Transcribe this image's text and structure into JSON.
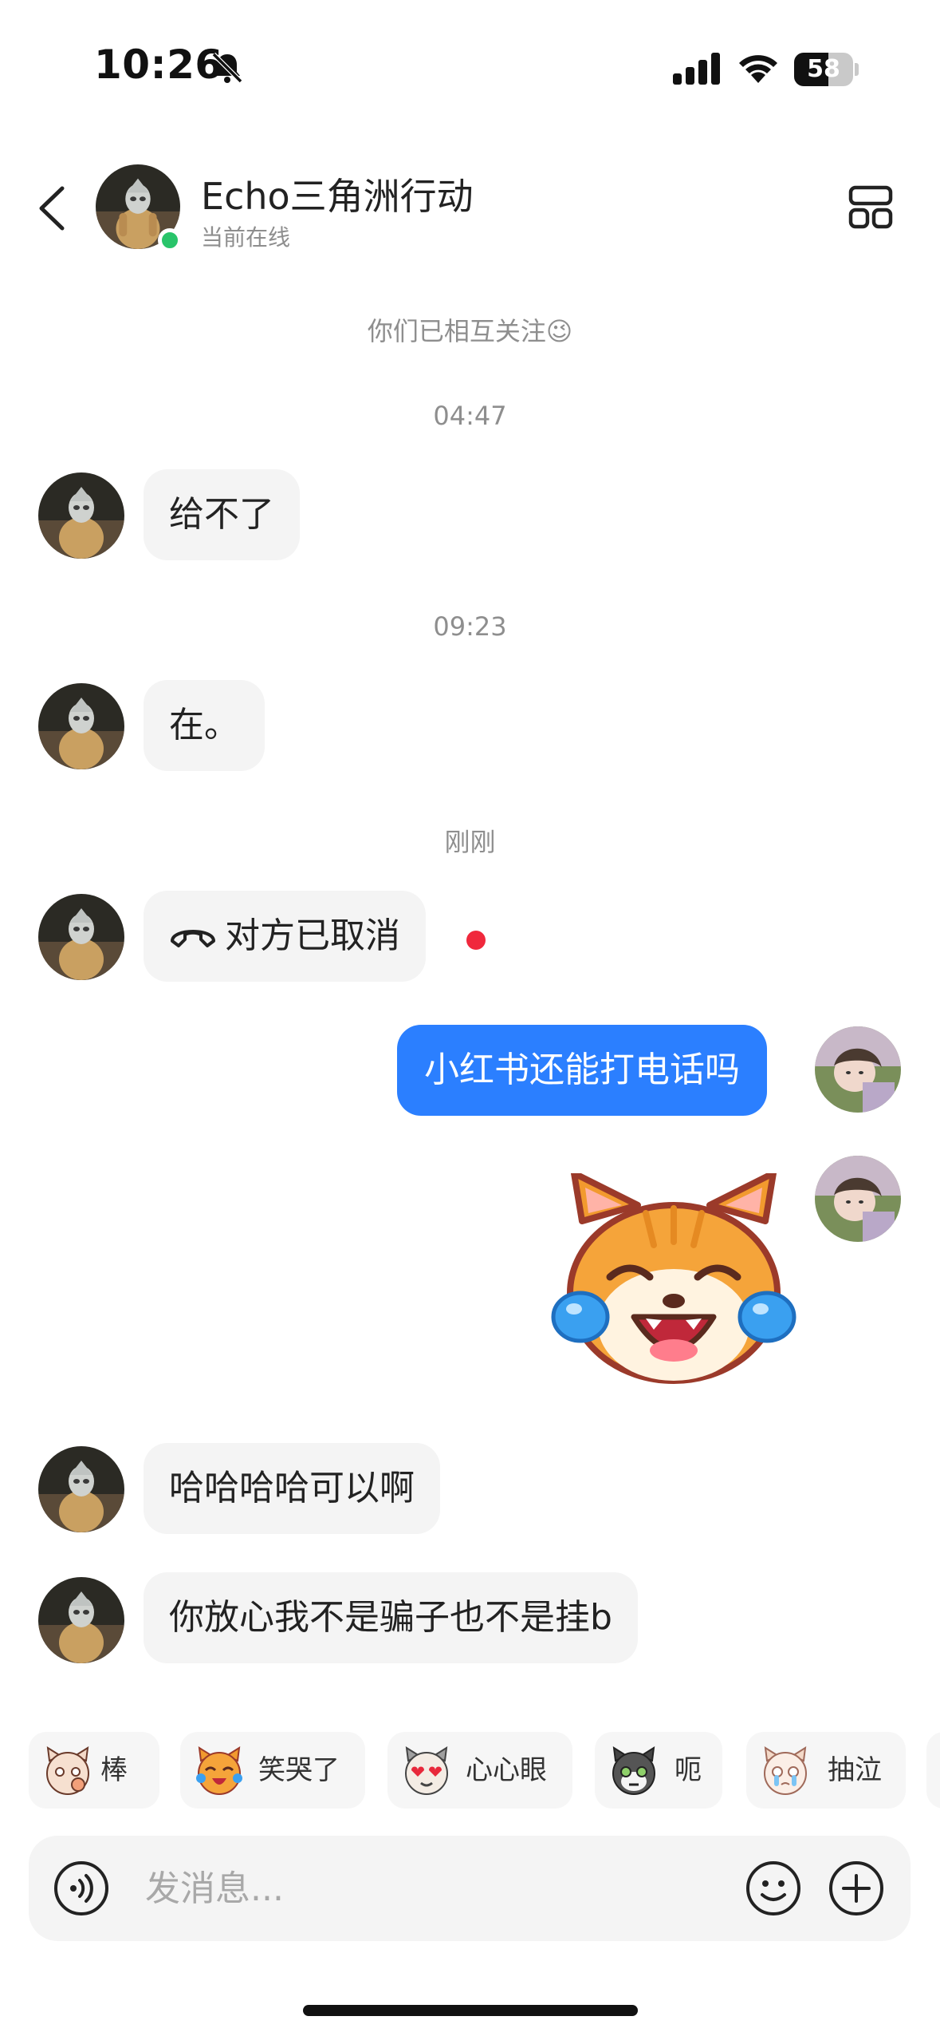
{
  "status_bar": {
    "time": "10:26",
    "battery": "58",
    "battery_level": 0.58
  },
  "header": {
    "contact_name": "Echo三角洲行动",
    "contact_status": "当前在线"
  },
  "system": {
    "follow_note": "你们已相互关注😉",
    "time_1": "04:47",
    "time_2": "09:23",
    "time_3": "刚刚"
  },
  "messages": [
    {
      "from": "contact",
      "text": "给不了"
    },
    {
      "from": "contact",
      "text": "在。"
    },
    {
      "from": "contact",
      "type": "call",
      "text": "对方已取消"
    },
    {
      "from": "me",
      "text": "小红书还能打电话吗"
    },
    {
      "from": "me",
      "type": "sticker",
      "icon": "laughing-crying-cat-sticker"
    },
    {
      "from": "contact",
      "text": "哈哈哈哈可以啊"
    },
    {
      "from": "contact",
      "text": "你放心我不是骗子也不是挂b"
    }
  ],
  "quick_emojis": [
    {
      "label": "棒",
      "icon": "thumbs-cat-icon"
    },
    {
      "label": "笑哭了",
      "icon": "laugh-cry-cat-icon"
    },
    {
      "label": "心心眼",
      "icon": "heart-eyes-cat-icon"
    },
    {
      "label": "呃",
      "icon": "awkward-cat-icon"
    },
    {
      "label": "抽泣",
      "icon": "sob-cat-icon"
    }
  ],
  "input": {
    "placeholder": "发消息..."
  },
  "colors": {
    "accent": "#2b7fff",
    "online": "#29c46a",
    "unread": "#f0283c",
    "bubble_in": "#f4f4f4"
  }
}
